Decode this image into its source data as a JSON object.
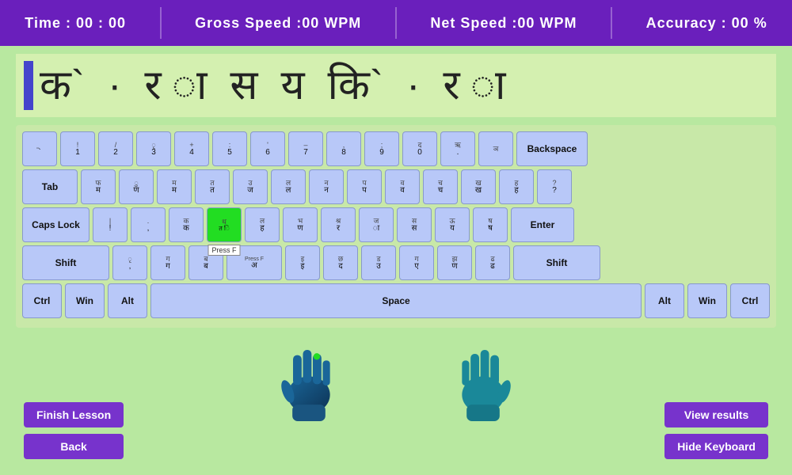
{
  "stats": {
    "time_label": "Time :",
    "time_value": "00 : 00",
    "gross_label": "Gross Speed :",
    "gross_value": "00",
    "gross_unit": "WPM",
    "net_label": "Net Speed :",
    "net_value": "00",
    "net_unit": "WPM",
    "accuracy_label": "Accuracy :",
    "accuracy_value": "00",
    "accuracy_unit": "%"
  },
  "text_display": {
    "text": "क`  ·  र ा  स  य  कि`  ·  र ा"
  },
  "keyboard": {
    "rows": [
      [
        "` ॒",
        "! 1",
        "/ 2",
        "ृ 3",
        "+ 4",
        ": 5",
        "' 6",
        "– 7",
        ", 8",
        "; 9",
        "द 0",
        "ऋ .",
        "ञ",
        "Backspace"
      ],
      [
        "Tab",
        "फ म",
        "ु ण",
        "म म",
        "त त",
        "उ ज",
        "ल ल",
        "न न",
        "प प",
        "व व",
        "च च",
        "ख ख",
        "ह ह",
        "? ?"
      ],
      [
        "Caps Lock",
        "| !",
        ". ,",
        "क क",
        "थ त",
        "ल ह",
        "भ ण",
        "श्र र",
        "ज ा",
        "स स",
        "ऊ य",
        "ष ष",
        "Enter"
      ],
      [
        "Shift",
        "ृ ,",
        "ग ग",
        "ब ब",
        "Press F अ",
        "इ इ",
        "छ द",
        "ड उ",
        "ग ए",
        "झ ण",
        "ढ ढ",
        "Shift"
      ],
      [
        "Ctrl",
        "Win",
        "Alt",
        "Space",
        "Alt",
        "Win",
        "Ctrl"
      ]
    ]
  },
  "buttons": {
    "finish_lesson": "Finish Lesson",
    "back": "Back",
    "view_results": "View results",
    "hide_keyboard": "Hide Keyboard"
  },
  "tooltip": "Press F",
  "colors": {
    "bg": "#b8e8a0",
    "stats_bar": "#6a1fbc",
    "key_normal": "#b8c8f8",
    "key_active": "#22dd22",
    "btn": "#7733cc"
  }
}
